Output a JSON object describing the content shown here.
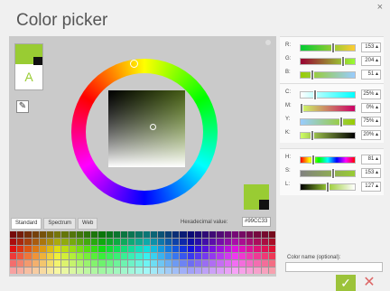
{
  "window": {
    "title": "Color picker",
    "close": "×"
  },
  "preview": {
    "letter": "A",
    "color": "#99cc33"
  },
  "hex": {
    "label": "Hexadecimal value:",
    "value": "#99CC33"
  },
  "tabs": [
    "Standard",
    "Spectrum",
    "Web"
  ],
  "rgb": [
    {
      "label": "R:",
      "value": "153",
      "pct": 0.6,
      "grad": "linear-gradient(to right, #00cc33, #ffcc33)"
    },
    {
      "label": "G:",
      "value": "204",
      "pct": 0.8,
      "grad": "linear-gradient(to right, #990033, #99ff33)"
    },
    {
      "label": "B:",
      "value": "51",
      "pct": 0.2,
      "grad": "linear-gradient(to right, #99cc00, #99ccff)"
    }
  ],
  "cmyk": [
    {
      "label": "C:",
      "value": "25%",
      "pct": 0.25,
      "grad": "linear-gradient(to right, #fff, #0ff)"
    },
    {
      "label": "M:",
      "value": "0%",
      "pct": 0.0,
      "grad": "linear-gradient(to right, #ccff66, #cc0066)"
    },
    {
      "label": "Y:",
      "value": "75%",
      "pct": 0.75,
      "grad": "linear-gradient(to right, #99ccff, #99cc00)"
    },
    {
      "label": "K:",
      "value": "20%",
      "pct": 0.2,
      "grad": "linear-gradient(to right, #cfff66, #000)"
    }
  ],
  "hsl": [
    {
      "label": "H:",
      "value": "81",
      "pct": 0.22,
      "grad": "linear-gradient(to right, #f00, #ff0, #0f0, #0ff, #00f, #f0f, #f00)"
    },
    {
      "label": "S:",
      "value": "153",
      "pct": 0.6,
      "grad": "linear-gradient(to right, #808080, #99cc33)"
    },
    {
      "label": "L:",
      "value": "127",
      "pct": 0.5,
      "grad": "linear-gradient(to right, #000, #99cc33, #fff)"
    }
  ],
  "color_name": {
    "label": "Color name (optional):",
    "value": ""
  },
  "buttons": {
    "ok": "✓",
    "cancel": "✕"
  }
}
